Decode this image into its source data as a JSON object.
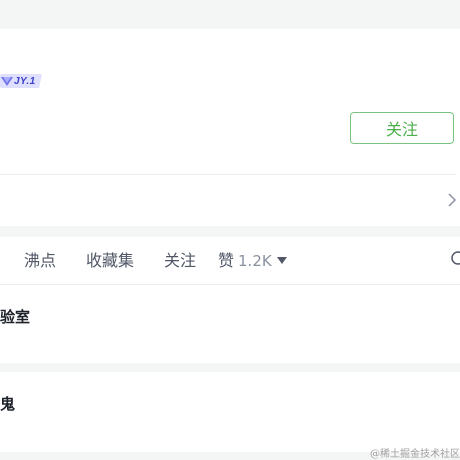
{
  "profile": {
    "level_badge": "JY.1",
    "follow_label": "关注"
  },
  "tabs": [
    {
      "label": "沸点"
    },
    {
      "label": "收藏集"
    },
    {
      "label": "关注"
    },
    {
      "label": "赞",
      "count": "1.2K"
    }
  ],
  "items": [
    {
      "title": "验室"
    },
    {
      "title": "鬼"
    }
  ],
  "watermark": "@稀土掘金技术社区",
  "colors": {
    "follow_border": "#7bc47f",
    "follow_text": "#4cae4c",
    "level_badge_bg": "#dfe0ff",
    "level_badge_text": "#3b3fc9"
  },
  "icons": [
    "level-badge-icon",
    "chevron-right-icon",
    "search-icon",
    "caret-down-icon"
  ]
}
